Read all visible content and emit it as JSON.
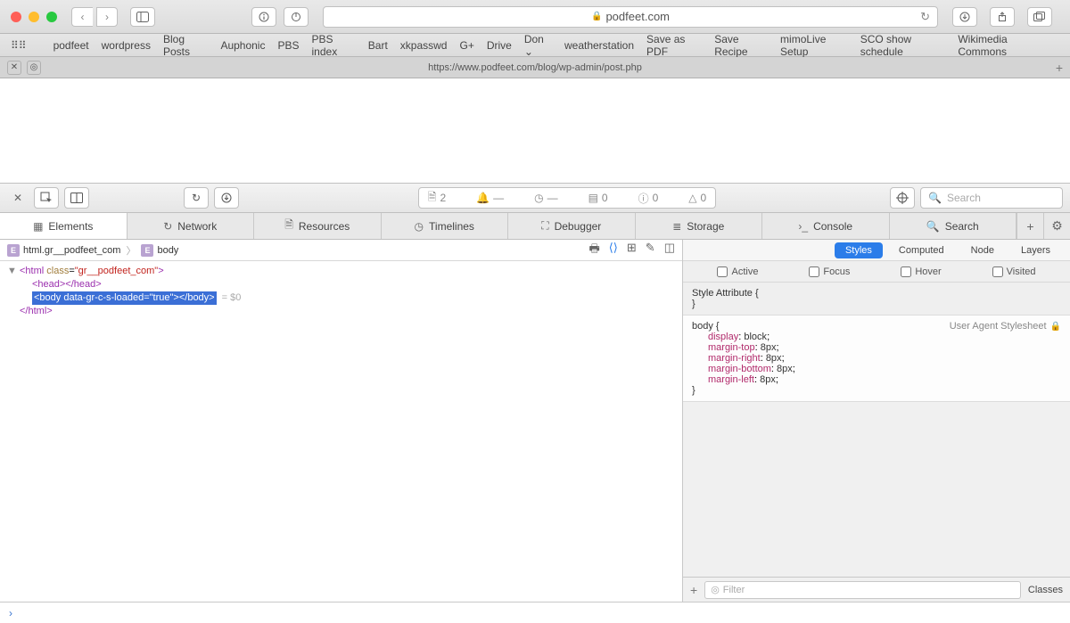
{
  "browser": {
    "address": "podfeet.com",
    "bookmarks": [
      "podfeet",
      "wordpress",
      "Blog Posts",
      "Auphonic",
      "PBS",
      "PBS index",
      "Bart",
      "xkpasswd",
      "G+",
      "Drive",
      "Don ⌄",
      "weatherstation",
      "Save as PDF",
      "Save Recipe",
      "mimoLive Setup",
      "SCO show schedule",
      "Wikimedia Commons"
    ],
    "tab_url": "https://www.podfeet.com/blog/wp-admin/post.php"
  },
  "devtools": {
    "toolbar": {
      "file_count": "2",
      "errors": "—",
      "warnings": "—",
      "logs": "0",
      "info": "0",
      "tri": "0",
      "search_placeholder": "Search"
    },
    "tabs": {
      "elements": "Elements",
      "network": "Network",
      "resources": "Resources",
      "timelines": "Timelines",
      "debugger": "Debugger",
      "storage": "Storage",
      "console": "Console",
      "search": "Search"
    },
    "breadcrumb": {
      "root": "html.gr__podfeet_com",
      "child": "body"
    },
    "dom": {
      "html_open": "<html class=\"gr__podfeet_com\">",
      "head": "<head></head>",
      "body_line": "<body data-gr-c-s-loaded=\"true\"></body>",
      "eq0": "= $0",
      "html_close": "</html>"
    },
    "styles": {
      "tabs": {
        "styles": "Styles",
        "computed": "Computed",
        "node": "Node",
        "layers": "Layers"
      },
      "pseudo": {
        "active": "Active",
        "focus": "Focus",
        "hover": "Hover",
        "visited": "Visited"
      },
      "attr_label": "Style Attribute",
      "body_selector": "body",
      "source_label": "User Agent Stylesheet",
      "props": [
        {
          "name": "display",
          "value": "block"
        },
        {
          "name": "margin-top",
          "value": "8px"
        },
        {
          "name": "margin-right",
          "value": "8px"
        },
        {
          "name": "margin-bottom",
          "value": "8px"
        },
        {
          "name": "margin-left",
          "value": "8px"
        }
      ],
      "filter_placeholder": "Filter",
      "classes_label": "Classes"
    },
    "console_prompt": "›"
  }
}
